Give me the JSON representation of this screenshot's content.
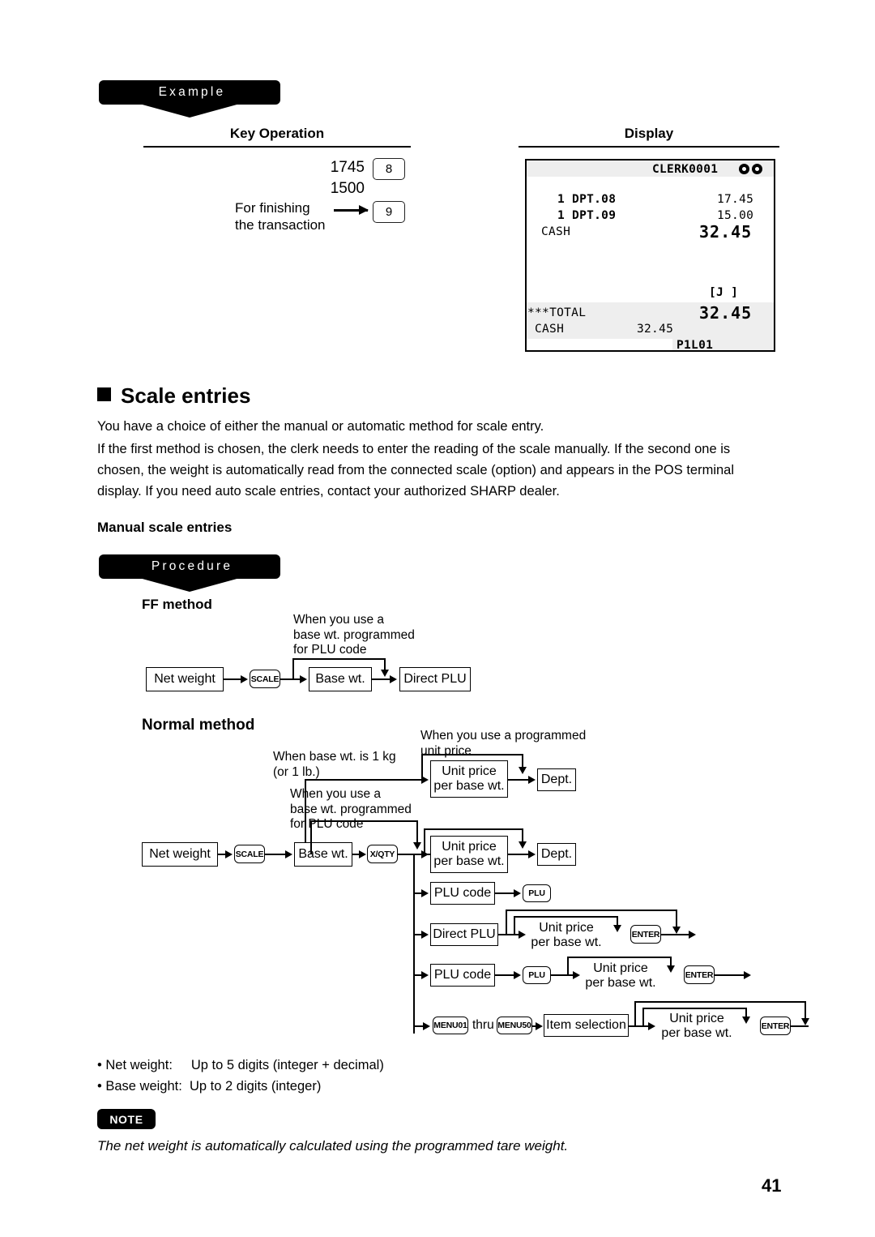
{
  "page": {
    "number": "41"
  },
  "example": {
    "banner": "Example",
    "key_operation_header": "Key Operation",
    "display_header": "Display",
    "entries": [
      {
        "amount": "1745",
        "key": "8"
      },
      {
        "amount": "1500",
        "key": ""
      }
    ],
    "finishing_label_line1": "For finishing",
    "finishing_label_line2": "the transaction",
    "finishing_key": "9"
  },
  "pos_display": {
    "clerk": "CLERK0001",
    "lines": [
      {
        "qty": "1 DPT.08",
        "amount": "17.45"
      },
      {
        "qty": "1 DPT.09",
        "amount": "15.00"
      },
      {
        "qty": "CASH",
        "amount": "32.45"
      }
    ],
    "journal_flag": "[J ]",
    "total_label": "***TOTAL",
    "total_amount": "32.45",
    "tender_label": "CASH",
    "tender_amount": "32.45",
    "page_line": "P1L01"
  },
  "section": {
    "title": "Scale entries",
    "paragraph1": "You have a choice of either the manual or automatic method for scale entry.",
    "paragraph2_line1": "If the first method is chosen, the clerk needs to enter the reading of the scale manually.  If the second one is",
    "paragraph2_line2": "chosen, the weight is automatically read from the connected scale (option) and appears in the POS terminal",
    "paragraph2_line3": "display. If you need auto scale entries, contact your authorized SHARP dealer.",
    "subheading": "Manual scale entries",
    "procedure_banner": "Procedure"
  },
  "ff_method": {
    "title": "FF method",
    "note_line1": "When you use a",
    "note_line2": "base wt. programmed",
    "note_line3": "for PLU code",
    "nodes": {
      "net_weight": "Net weight",
      "scale_key": "SCALE",
      "base_wt": "Base wt.",
      "direct_plu": "Direct PLU"
    }
  },
  "normal_method": {
    "title": "Normal method",
    "labels": {
      "programmed_unit_price_l1": "When you use a programmed",
      "programmed_unit_price_l2": "unit price",
      "base_wt_1kg_l1": "When base wt. is 1 kg",
      "base_wt_1kg_l2": "(or 1 lb.)",
      "base_wt_plu_l1": "When you use a",
      "base_wt_plu_l2": "base wt. programmed",
      "base_wt_plu_l3": "for PLU code"
    },
    "nodes": {
      "net_weight": "Net weight",
      "scale_key": "SCALE",
      "base_wt": "Base wt.",
      "xqty_key": "X/QTY",
      "unit_price_l1": "Unit price",
      "unit_price_l2": "per base wt.",
      "dept": "Dept.",
      "plu_code": "PLU code",
      "plu_key": "PLU",
      "direct_plu": "Direct PLU",
      "enter_key": "ENTER",
      "menu01_key": "MENU01",
      "thru": "thru",
      "menu50_key": "MENU50",
      "item_selection": "Item selection"
    }
  },
  "specs": {
    "bullet1": "• Net weight:     Up to 5 digits (integer + decimal)",
    "bullet2": "• Base weight:  Up to 2 digits (integer)"
  },
  "note": {
    "badge": "NOTE",
    "text": "The net weight is automatically calculated using the programmed tare weight."
  }
}
